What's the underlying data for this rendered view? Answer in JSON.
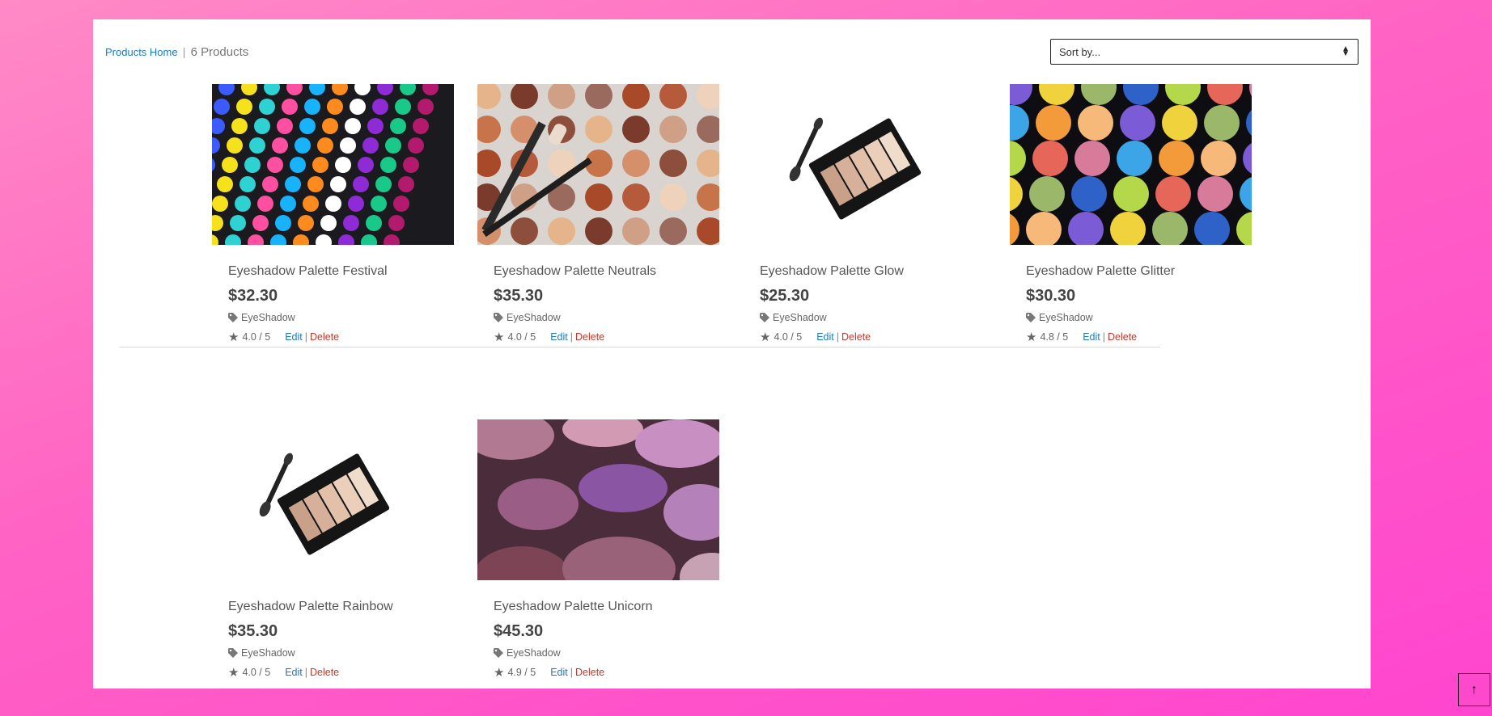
{
  "breadcrumb": {
    "home_link": "Products Home",
    "separator": "|",
    "count": "6 Products"
  },
  "sort": {
    "selected": "Sort by..."
  },
  "product_actions": {
    "edit": "Edit",
    "separator": "|",
    "delete": "Delete"
  },
  "products": [
    {
      "name": "Eyeshadow Palette Festival",
      "price": "$32.30",
      "category": "EyeShadow",
      "rating": "4.0 / 5",
      "image": "rainbow-dots"
    },
    {
      "name": "Eyeshadow Palette Neutrals",
      "price": "$35.30",
      "category": "EyeShadow",
      "rating": "4.0 / 5",
      "image": "neutral-brushes"
    },
    {
      "name": "Eyeshadow Palette Glow",
      "price": "$25.30",
      "category": "EyeShadow",
      "rating": "4.0 / 5",
      "image": "compact-palette"
    },
    {
      "name": "Eyeshadow Palette Glitter",
      "price": "$30.30",
      "category": "EyeShadow",
      "rating": "4.8 / 5",
      "image": "glitter-pans"
    },
    {
      "name": "Eyeshadow Palette Rainbow",
      "price": "$35.30",
      "category": "EyeShadow",
      "rating": "4.0 / 5",
      "image": "compact-palette"
    },
    {
      "name": "Eyeshadow Palette Unicorn",
      "price": "$45.30",
      "category": "EyeShadow",
      "rating": "4.9 / 5",
      "image": "purple-closeup"
    }
  ],
  "icons": {
    "tag": "tag-icon",
    "star": "star-icon",
    "sort": "sort-arrows-icon",
    "scroll_top": "arrow-up-icon"
  },
  "colors": {
    "link": "#1a7bc0",
    "delete": "#c0392b",
    "background": "#ff62c4"
  }
}
